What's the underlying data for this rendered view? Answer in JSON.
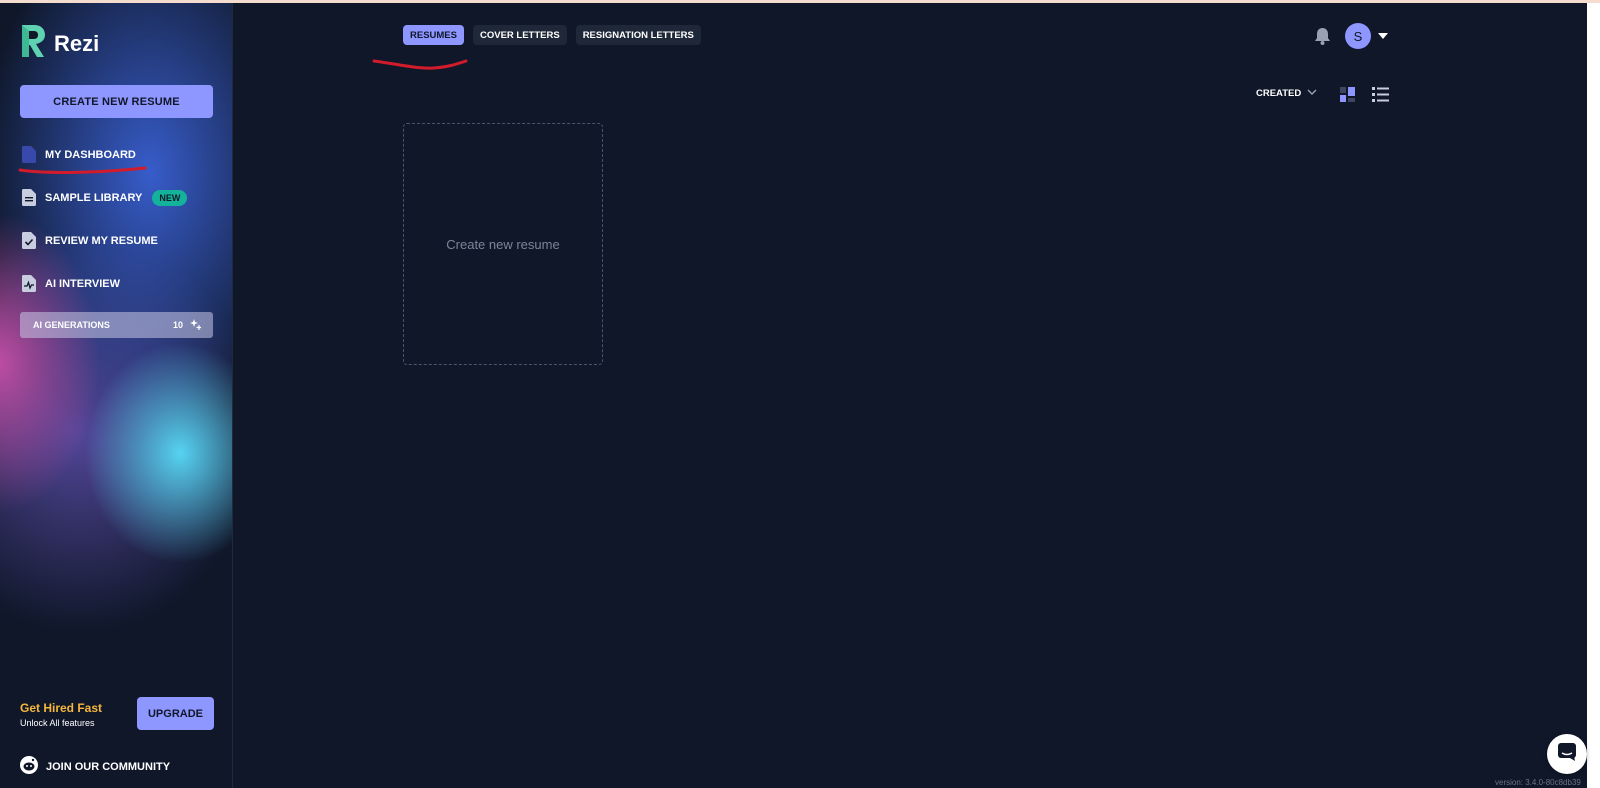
{
  "app": {
    "name": "Rezi"
  },
  "colors": {
    "accent": "#8e96ff",
    "background": "#0f1729",
    "badge_green": "#12b39a",
    "highlight_yellow": "#f6b73c",
    "annotation_red": "#d21b2b"
  },
  "sidebar": {
    "create_button": "CREATE NEW RESUME",
    "items": [
      {
        "label": "MY DASHBOARD",
        "icon": "document-icon"
      },
      {
        "label": "SAMPLE LIBRARY",
        "icon": "file-lines-icon",
        "badge": "NEW"
      },
      {
        "label": "REVIEW MY RESUME",
        "icon": "file-check-icon"
      },
      {
        "label": "AI INTERVIEW",
        "icon": "file-pulse-icon"
      }
    ],
    "ai_generations": {
      "label": "AI GENERATIONS",
      "count": "10",
      "icon": "sparkle-plus-icon"
    },
    "promo": {
      "title": "Get Hired Fast",
      "subtitle": "Unlock All features",
      "button": "UPGRADE"
    },
    "community": {
      "label": "JOIN OUR COMMUNITY",
      "icon": "reddit-icon"
    }
  },
  "header": {
    "tabs": [
      {
        "label": "RESUMES",
        "active": true
      },
      {
        "label": "COVER LETTERS",
        "active": false
      },
      {
        "label": "RESIGNATION LETTERS",
        "active": false
      }
    ],
    "notification_icon": "bell-icon",
    "user": {
      "initial": "S"
    }
  },
  "toolbar": {
    "sort_label": "CREATED",
    "view_modes": [
      "grid-view-icon",
      "list-view-icon"
    ]
  },
  "main": {
    "create_card_label": "Create new resume"
  },
  "footer": {
    "version": "version: 3.4.0-80c8db39"
  }
}
